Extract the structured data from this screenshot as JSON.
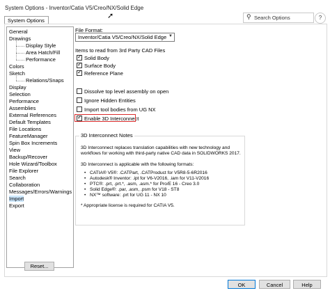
{
  "window": {
    "title": "System Options - Inventor/Catia V5/Creo/NX/Solid Edge",
    "search_placeholder": "Search Options",
    "help_icon": "?"
  },
  "tabs": [
    {
      "label": "System Options",
      "selected": true
    }
  ],
  "tree": {
    "items": [
      {
        "label": "General"
      },
      {
        "label": "Drawings"
      },
      {
        "label": "Display Style"
      },
      {
        "label": "Area Hatch/Fill"
      },
      {
        "label": "Performance"
      },
      {
        "label": "Colors"
      },
      {
        "label": "Sketch"
      },
      {
        "label": "Relations/Snaps"
      },
      {
        "label": "Display"
      },
      {
        "label": "Selection"
      },
      {
        "label": "Performance"
      },
      {
        "label": "Assemblies"
      },
      {
        "label": "External References"
      },
      {
        "label": "Default Templates"
      },
      {
        "label": "File Locations"
      },
      {
        "label": "FeatureManager"
      },
      {
        "label": "Spin Box Increments"
      },
      {
        "label": "View"
      },
      {
        "label": "Backup/Recover"
      },
      {
        "label": "Hole Wizard/Toolbox"
      },
      {
        "label": "File Explorer"
      },
      {
        "label": "Search"
      },
      {
        "label": "Collaboration"
      },
      {
        "label": "Messages/Errors/Warnings"
      },
      {
        "label": "Import"
      },
      {
        "label": "Export"
      }
    ],
    "reset_label": "Reset..."
  },
  "main": {
    "file_format_label": "File Format:",
    "file_format_value": "Inventor/Catia V5/Creo/NX/Solid Edge",
    "items_to_read_label": "Items to read from 3rd Party CAD Files",
    "checkboxes": [
      {
        "label": "Solid Body",
        "checked": true
      },
      {
        "label": "Surface Body",
        "checked": true
      },
      {
        "label": "Reference Plane",
        "checked": true
      },
      {
        "label": "Dissolve top level assembly on open",
        "checked": false
      },
      {
        "label": "Ignore Hidden Entities",
        "checked": false
      },
      {
        "label": "Import tool bodies from UG NX",
        "checked": false
      },
      {
        "label": "Enable 3D Interconnect",
        "checked": true
      }
    ],
    "notes": {
      "title": "3D Interconnect Notes",
      "para1": "3D Interconnect replaces translation capabilities with new technology and workflows for working with third-party native CAD data in SOLIDWORKS 2017.",
      "para2": "3D Interconnect is applicable with the following formats:",
      "formats": [
        "CATIA® V5®: .CATPart, .CATProduct for V5R8-5-6R2016",
        "Autodesk® Inventor: .ipt for V6-V2016, .iam for V11-V2016",
        "PTC®: .prt, .prt.*, .asm, .asm.* for Pro/E 16 - Creo 3.0",
        "Solid Edge®: .par, .asm, .psm for V18 - ST8",
        "NX™ software: .prt for UG 11 - NX 10"
      ],
      "footnote": "* Appropriate license is required for CATIA V5."
    }
  },
  "footer": {
    "ok": "OK",
    "cancel": "Cancel",
    "help": "Help"
  },
  "colors": {
    "highlight": "#d92b2b",
    "ok_border": "#0078d7"
  }
}
